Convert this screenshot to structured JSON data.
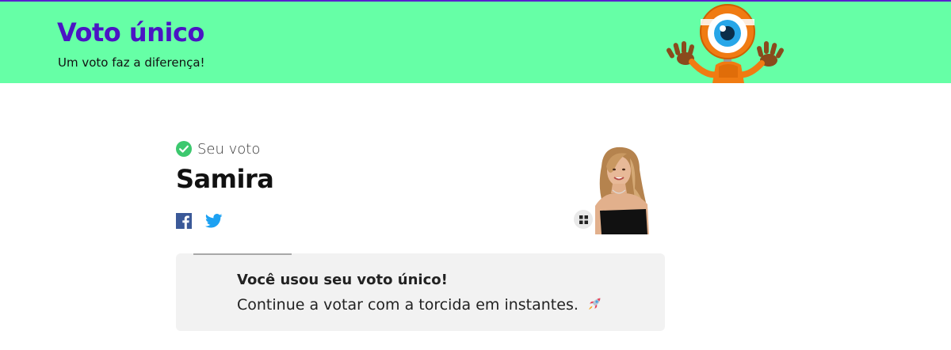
{
  "header": {
    "title": "Voto único",
    "subtitle": "Um voto faz a diferença!",
    "background": "#66ffa6",
    "title_color": "#4b14c4",
    "mascot_icon": "big-brother-eye-mascot"
  },
  "vote": {
    "label": "Seu voto",
    "label_icon": "check-circle-icon",
    "candidate": "Samira",
    "share": {
      "facebook_icon": "facebook-icon",
      "twitter_icon": "twitter-icon"
    },
    "photo_expand_icon": "expand-grid-icon"
  },
  "notice": {
    "title": "Você usou seu voto único!",
    "text": "Continue a votar com a torcida em instantes.",
    "emoji_icon": "rocket-icon"
  },
  "colors": {
    "accent_green": "#3cc86e",
    "facebook_blue": "#3b5998",
    "twitter_blue": "#1da1f2"
  }
}
